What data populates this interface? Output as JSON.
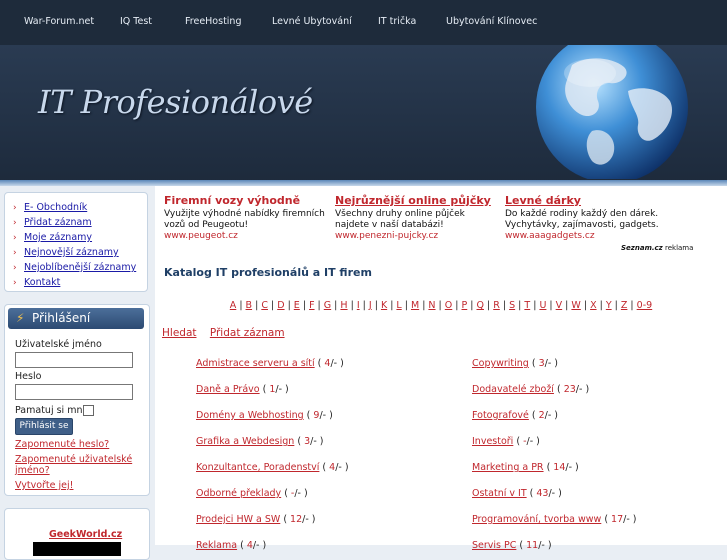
{
  "nav": {
    "items": [
      "War-Forum.net",
      "IQ Test",
      "FreeHosting",
      "Levné Ubytování",
      "IT trička",
      "Ubytování Klínovec"
    ]
  },
  "header": {
    "logo_text": "IT Profesionálové"
  },
  "sidebar": {
    "menu": [
      "E- Obchodník",
      "Přidat záznam",
      "Moje záznamy",
      "Nejnovější záznamy",
      "Nejoblíbenější záznamy",
      "Kontakt"
    ],
    "login": {
      "title": "Přihlášení",
      "username_label": "Uživatelské jméno",
      "username_value": "",
      "password_label": "Heslo",
      "password_value": "",
      "remember_label": "Pamatuj si mne",
      "submit_label": "Přihlásit se",
      "forgot_password": "Zapomenuté heslo?",
      "forgot_username_1": "Zapomenuté uživatelské",
      "forgot_username_2": "jméno?",
      "register": "Vytvořte jej!"
    },
    "ad_title": "GeekWorld.cz"
  },
  "ads": [
    {
      "title": "Firemní vozy výhodně",
      "desc": "Využijte výhodné nabídky firemních vozů od Peugeotu!",
      "url": "www.peugeot.cz"
    },
    {
      "title": "Nejrůznější online půjčky",
      "desc": "Všechny druhy online půjček najdete v naší databázi!",
      "url": "www.penezni-pujcky.cz"
    },
    {
      "title": "Levné dárky",
      "desc": "Do každé rodiny každý den dárek. Vychytávky, zajímavosti, gadgets.",
      "url": "www.aaagadgets.cz"
    }
  ],
  "seznam": {
    "brand": "Seznam.cz",
    "label": "reklama"
  },
  "catalog": {
    "title": "Katalog IT profesionálů a IT firem",
    "letters": [
      "A",
      "B",
      "C",
      "D",
      "E",
      "F",
      "G",
      "H",
      "I",
      "J",
      "K",
      "L",
      "M",
      "N",
      "O",
      "P",
      "Q",
      "R",
      "S",
      "T",
      "U",
      "V",
      "W",
      "X",
      "Y",
      "Z",
      "0-9"
    ],
    "actions": [
      "Hledat",
      "Přidat záznam"
    ],
    "left": [
      {
        "name": "Admistrace serveru a sítí",
        "count": "4"
      },
      {
        "name": "Daně a Právo",
        "count": "1"
      },
      {
        "name": "Domény a Webhosting",
        "count": "9"
      },
      {
        "name": "Grafika a Webdesign",
        "count": "3"
      },
      {
        "name": "Konzultantce, Poradenství",
        "count": "4"
      },
      {
        "name": "Odborné překlady",
        "count": "-"
      },
      {
        "name": "Prodejci HW a SW",
        "count": "12"
      },
      {
        "name": "Reklama",
        "count": "4"
      }
    ],
    "right": [
      {
        "name": "Copywriting",
        "count": "3"
      },
      {
        "name": "Dodavatelé zboží",
        "count": "23"
      },
      {
        "name": "Fotografové",
        "count": "2"
      },
      {
        "name": "Investoři",
        "count": "-"
      },
      {
        "name": "Marketing a PR",
        "count": "14"
      },
      {
        "name": "Ostatní v IT",
        "count": "43"
      },
      {
        "name": "Programování, tvorba www",
        "count": "17"
      },
      {
        "name": "Servis PC",
        "count": "11"
      }
    ]
  }
}
